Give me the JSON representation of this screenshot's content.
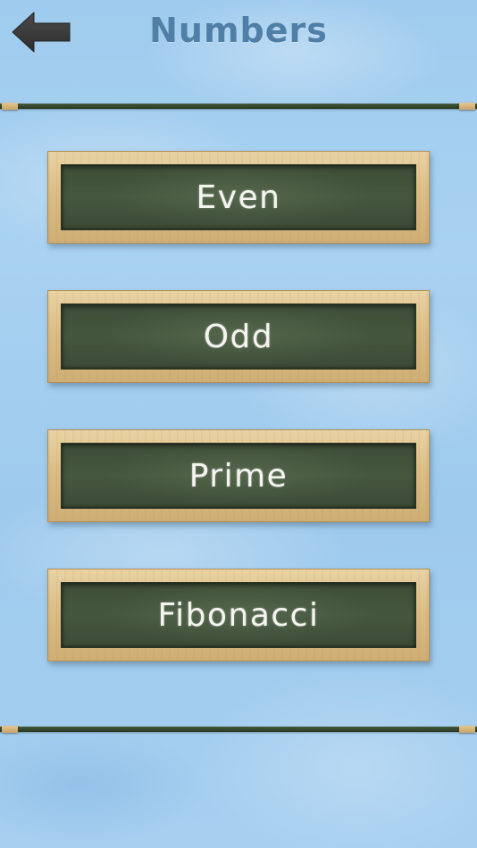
{
  "header": {
    "title": "Numbers",
    "back_icon": "back-arrow-icon"
  },
  "menu": {
    "items": [
      {
        "label": "Even"
      },
      {
        "label": "Odd"
      },
      {
        "label": "Prime"
      },
      {
        "label": "Fibonacci"
      }
    ]
  },
  "colors": {
    "title": "#4f7fa6",
    "background": "#a6cff0",
    "chalkboard": "#46573f",
    "frame_wood": "#dcbd85",
    "chalk_text": "#f5f5ef",
    "back_arrow": "#3c3c3c"
  }
}
